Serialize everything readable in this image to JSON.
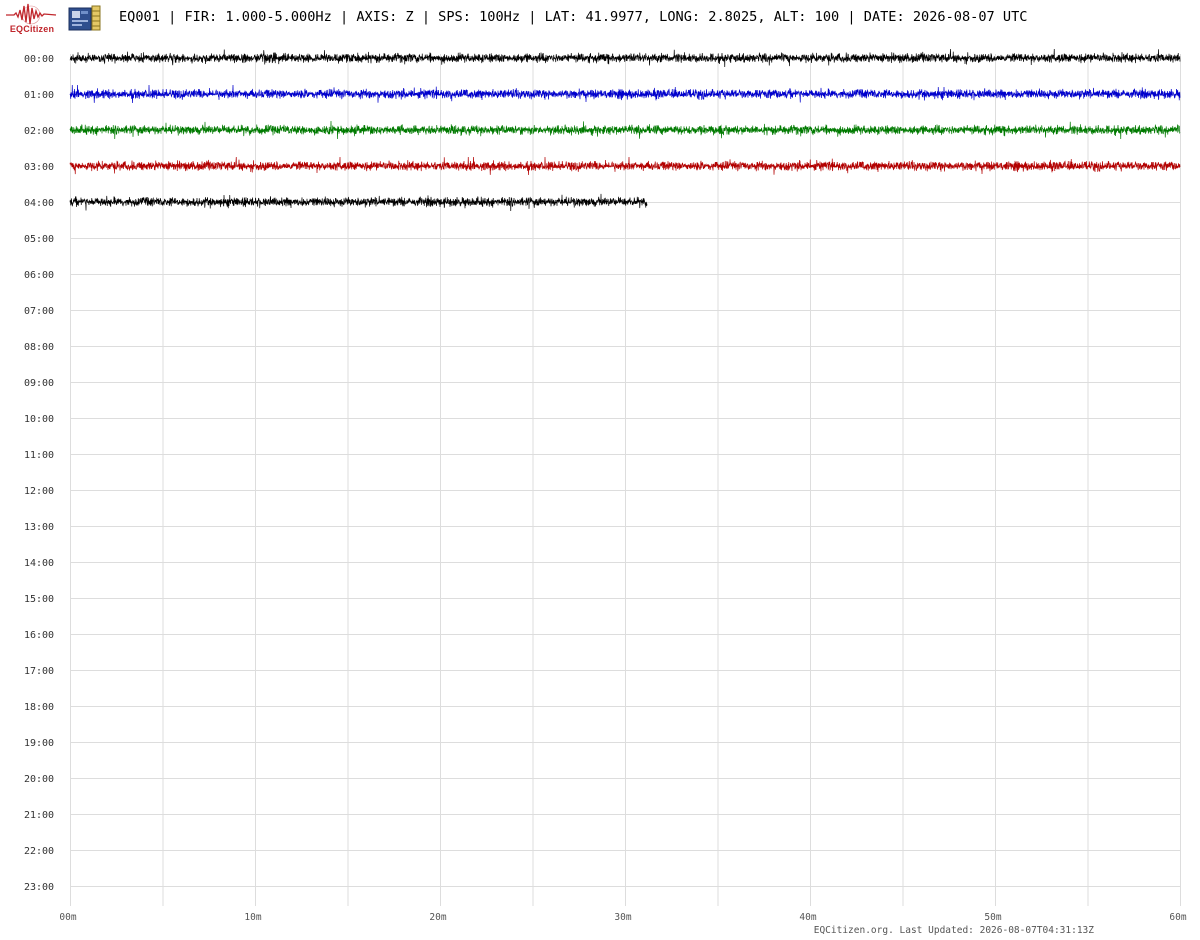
{
  "header": {
    "title": "EQ001 | FIR: 1.000-5.000Hz | AXIS: Z | SPS: 100Hz | LAT: 41.9977, LONG: 2.8025, ALT: 100 | DATE: 2026-08-07 UTC",
    "logo_text": "EQCitizen",
    "logo_icon": "seismogram-logo-icon",
    "device_icon": "sensor-board-icon"
  },
  "colors": {
    "trace_cycle": [
      "#000000",
      "#0000cc",
      "#007a00",
      "#b30000"
    ],
    "grid": "#dddddd",
    "brand": "#c0262c"
  },
  "chart_data": {
    "type": "helicorder",
    "x_axis": {
      "unit": "minutes",
      "range": [
        0,
        60
      ],
      "tick_labels": [
        "00m",
        "10m",
        "20m",
        "30m",
        "40m",
        "50m",
        "60m"
      ],
      "minor_grid_every_minutes": 5
    },
    "rows": [
      "00:00",
      "01:00",
      "02:00",
      "03:00",
      "04:00",
      "05:00",
      "06:00",
      "07:00",
      "08:00",
      "09:00",
      "10:00",
      "11:00",
      "12:00",
      "13:00",
      "14:00",
      "15:00",
      "16:00",
      "17:00",
      "18:00",
      "19:00",
      "20:00",
      "21:00",
      "22:00",
      "23:00"
    ],
    "series": [
      {
        "hour": "00:00",
        "color": "#000000",
        "start_min": 0,
        "end_min": 60
      },
      {
        "hour": "01:00",
        "color": "#0000cc",
        "start_min": 0,
        "end_min": 60
      },
      {
        "hour": "02:00",
        "color": "#007a00",
        "start_min": 0,
        "end_min": 60
      },
      {
        "hour": "03:00",
        "color": "#b30000",
        "start_min": 0,
        "end_min": 60
      },
      {
        "hour": "04:00",
        "color": "#000000",
        "start_min": 0,
        "end_min": 31.2
      }
    ],
    "grid": true
  },
  "footer": {
    "note": "EQCitizen.org. Last Updated: 2026-08-07T04:31:13Z"
  }
}
